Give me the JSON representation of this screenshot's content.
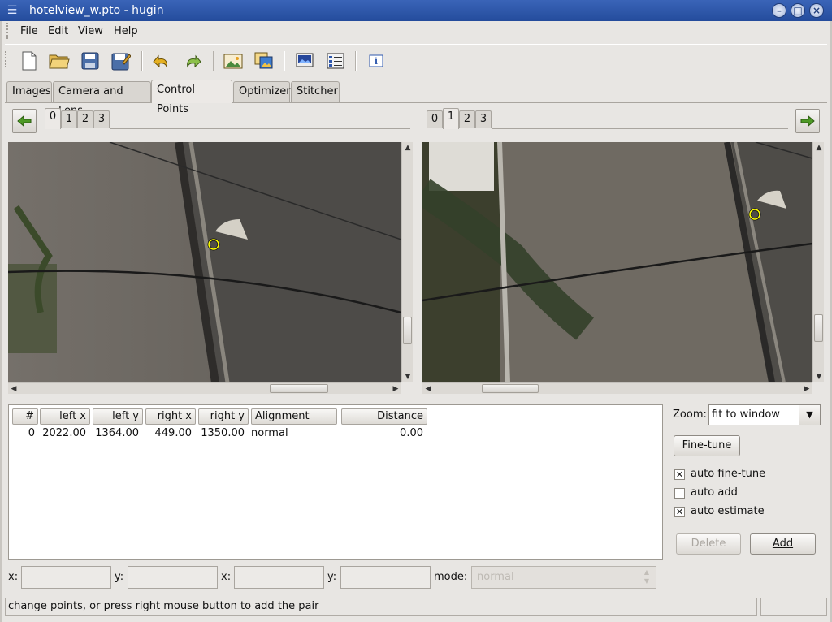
{
  "window": {
    "title": "hotelview_w.pto - hugin",
    "app_icon": "hugin-icon"
  },
  "menu": [
    {
      "label": "File"
    },
    {
      "label": "Edit"
    },
    {
      "label": "View"
    },
    {
      "label": "Help"
    }
  ],
  "toolbar": {
    "icons": [
      "new-project-icon",
      "open-project-icon",
      "save-icon",
      "save-as-icon",
      "undo-icon",
      "redo-icon",
      "add-image-icon",
      "add-time-series-icon",
      "preview-icon",
      "cp-list-icon",
      "about-icon"
    ]
  },
  "tabs": [
    {
      "label": "Images"
    },
    {
      "label": "Camera and Lens"
    },
    {
      "label": "Control Points",
      "active": true
    },
    {
      "label": "Optimizer"
    },
    {
      "label": "Stitcher"
    }
  ],
  "left_image": {
    "tabs": [
      "0",
      "1",
      "2",
      "3"
    ],
    "selected": "0"
  },
  "right_image": {
    "tabs": [
      "0",
      "1",
      "2",
      "3"
    ],
    "selected": "1"
  },
  "table": {
    "columns": [
      "#",
      "left x",
      "left y",
      "right x",
      "right y",
      "Alignment",
      "Distance"
    ],
    "rows": [
      [
        "0",
        "2022.00",
        "1364.00",
        "449.00",
        "1350.00",
        "normal",
        "0.00"
      ]
    ]
  },
  "controls": {
    "zoom_label": "Zoom:",
    "zoom_value": "fit to window",
    "finetune_label": "Fine-tune",
    "auto_finetune": {
      "label": "auto fine-tune",
      "checked": true
    },
    "auto_add": {
      "label": "auto add",
      "checked": false
    },
    "auto_estimate": {
      "label": "auto estimate",
      "checked": true
    },
    "delete_label": "Delete",
    "add_label": "Add"
  },
  "bottom": {
    "x_label": "x:",
    "y_label": "y:",
    "x2_label": "x:",
    "y2_label": "y:",
    "mode_label": "mode:",
    "mode_value": "normal"
  },
  "status": {
    "text": "change points, or press right mouse button to add the pair"
  },
  "colors": {
    "titlebar": "#2f58ae",
    "cp_marker": "#ffff00",
    "background": "#e8e6e3"
  }
}
